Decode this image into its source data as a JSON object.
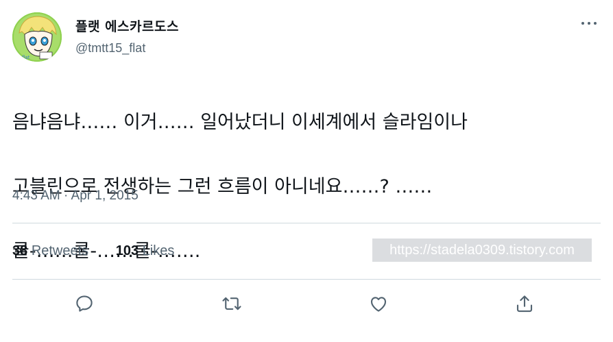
{
  "author": {
    "display_name": "플랫 에스카르도스",
    "handle": "@tmtt15_flat"
  },
  "tweet": {
    "text_lines": [
      "음냐음냐…… 이거…… 일어났더니 이세계에서 슬라임이나",
      "고블린으로 전생하는 그런 흐름이 아니네요……? ……",
      "쿨-……쿨-……쿨-……."
    ],
    "timestamp": "4:43 AM · Apr 1, 2015"
  },
  "stats": {
    "retweets_count": "38",
    "retweets_label": "Retweets",
    "likes_count": "103",
    "likes_label": "Likes"
  },
  "watermark": "https://stadela0309.tistory.com",
  "actions": [
    {
      "icon": "reply-icon"
    },
    {
      "icon": "retweet-icon"
    },
    {
      "icon": "like-icon"
    },
    {
      "icon": "share-icon"
    }
  ],
  "colors": {
    "text": "#0f1419",
    "secondary": "#536471",
    "divider": "#cfd9de",
    "accent": "#1d9bf0"
  }
}
